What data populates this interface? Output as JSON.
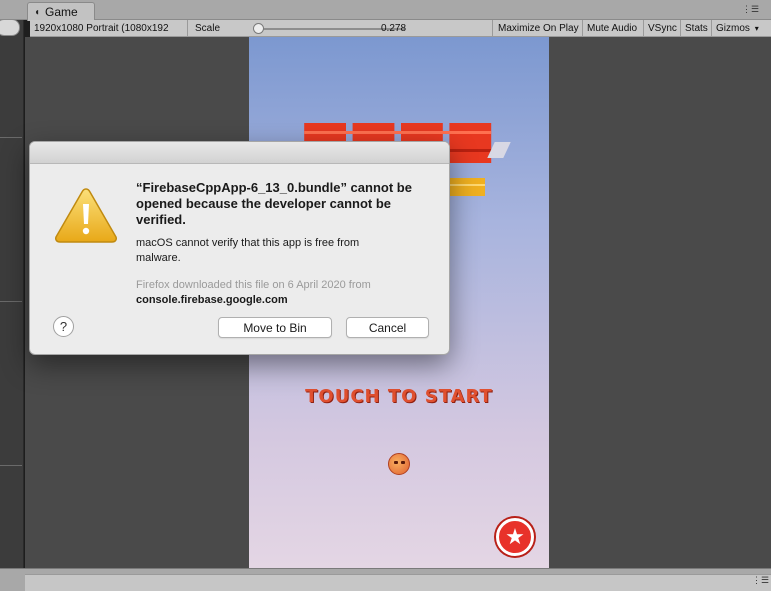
{
  "editor": {
    "tab_title": "Game",
    "tab_icon": "camera-icon",
    "menu_glyph": "⋮☰"
  },
  "toolbar": {
    "resolution": "1920x1080 Portrait (1080x192",
    "scale_label": "Scale",
    "scale_value": "0.278",
    "scale_fraction": 0.0,
    "maximize_on_play": "Maximize On Play",
    "mute_audio": "Mute Audio",
    "vsync": "VSync",
    "stats": "Stats",
    "gizmos": "Gizmos"
  },
  "game": {
    "touch_to_start": "TOUCH TO START",
    "star_button_icon": "star-icon"
  },
  "dialog": {
    "title": "“FirebaseCppApp-6_13_0.bundle” cannot be opened because the developer cannot be verified.",
    "message": "macOS cannot verify that this app is free from malware.",
    "info": "Firefox downloaded this file on 6 April 2020 from",
    "host": "console.firebase.google.com",
    "help_label": "?",
    "move_to_bin": "Move to Bin",
    "cancel": "Cancel",
    "icon": "warning-icon"
  },
  "colors": {
    "accent_red": "#e8322a",
    "warning_yellow": "#f2c230"
  }
}
